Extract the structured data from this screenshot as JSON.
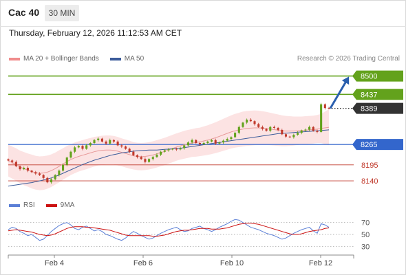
{
  "header": {
    "instrument": "Cac 40",
    "timeframe": "30 MIN"
  },
  "timestamp": "Thursday, February 12, 2026 11:12:53 AM CET",
  "legend": {
    "bollinger_label": "MA 20 + Bollinger Bands",
    "ma50_label": "MA 50"
  },
  "credit": "Research © 2026 Trading Central",
  "rsi_legend": {
    "rsi_label": "RSI",
    "ma_label": "9MA"
  },
  "colors": {
    "up": "#63a21c",
    "down": "#c0392b",
    "current": "#333333",
    "pivot": "#3366cc",
    "support": "#c0392b",
    "band_fill": "#fbdcdc",
    "ma20": "#e89a9a",
    "ma50": "#3b5b9a",
    "rsi": "#5b7fd6",
    "rsi_ma": "#cc1111",
    "arrow": "#2a5fae"
  },
  "chart_data": [
    {
      "type": "candlestick",
      "title": "",
      "x_ticks": [
        "Feb 4",
        "Feb 6",
        "Feb 10",
        "Feb 12"
      ],
      "ylim": [
        8100,
        8525
      ],
      "levels": [
        {
          "label": "8500",
          "value": 8500,
          "kind": "resistance"
        },
        {
          "label": "8437",
          "value": 8437,
          "kind": "resistance"
        },
        {
          "label": "8389",
          "value": 8389,
          "kind": "current"
        },
        {
          "label": "8265",
          "value": 8265,
          "kind": "pivot"
        },
        {
          "label": "8195",
          "value": 8195,
          "kind": "support"
        },
        {
          "label": "8140",
          "value": 8140,
          "kind": "support"
        }
      ],
      "close_series": [
        8210,
        8205,
        8190,
        8180,
        8185,
        8175,
        8170,
        8165,
        8160,
        8150,
        8135,
        8145,
        8160,
        8175,
        8195,
        8220,
        8240,
        8255,
        8260,
        8250,
        8262,
        8270,
        8280,
        8285,
        8275,
        8268,
        8280,
        8275,
        8262,
        8258,
        8250,
        8240,
        8228,
        8222,
        8215,
        8205,
        8215,
        8222,
        8230,
        8240,
        8245,
        8248,
        8250,
        8248,
        8252,
        8262,
        8272,
        8280,
        8270,
        8266,
        8270,
        8275,
        8280,
        8268,
        8272,
        8278,
        8284,
        8290,
        8305,
        8325,
        8340,
        8350,
        8345,
        8335,
        8325,
        8318,
        8312,
        8325,
        8322,
        8315,
        8300,
        8292,
        8290,
        8298,
        8305,
        8313,
        8316,
        8325,
        8312,
        8308,
        8403,
        8390,
        8389
      ],
      "ma20": [
        8210,
        8203,
        8196,
        8188,
        8182,
        8177,
        8172,
        8168,
        8166,
        8167,
        8170,
        8175,
        8182,
        8190,
        8198,
        8206,
        8213,
        8219,
        8224,
        8228,
        8232,
        8236,
        8240,
        8243,
        8245,
        8246,
        8246,
        8245,
        8242,
        8238,
        8234,
        8230,
        8226,
        8224,
        8223,
        8224,
        8226,
        8229,
        8233,
        8237,
        8241,
        8246,
        8251,
        8256,
        8260,
        8264,
        8267,
        8270,
        8272,
        8274,
        8277,
        8280,
        8284,
        8288,
        8293,
        8298,
        8303,
        8308,
        8312,
        8315,
        8318,
        8320,
        8321,
        8322,
        8322,
        8321,
        8320,
        8318,
        8316,
        8314,
        8312,
        8311,
        8311,
        8311,
        8312,
        8313,
        8314,
        8315,
        8316,
        8318,
        8320,
        8322,
        8324
      ],
      "ma50": [
        8122,
        8124,
        8126,
        8128,
        8130,
        8132,
        8134,
        8137,
        8140,
        8143,
        8146,
        8150,
        8155,
        8160,
        8166,
        8172,
        8178,
        8184,
        8190,
        8196,
        8201,
        8206,
        8211,
        8215,
        8219,
        8223,
        8227,
        8230,
        8233,
        8236,
        8238,
        8240,
        8242,
        8243,
        8244,
        8245,
        8246,
        8246,
        8246,
        8247,
        8248,
        8249,
        8250,
        8251,
        8252,
        8254,
        8256,
        8258,
        8260,
        8262,
        8264,
        8266,
        8268,
        8270,
        8272,
        8274,
        8276,
        8278,
        8280,
        8282,
        8284,
        8286,
        8288,
        8290,
        8292,
        8294,
        8296,
        8298,
        8300,
        8302,
        8303,
        8304,
        8305,
        8306,
        8307,
        8308,
        8309,
        8310,
        8311,
        8312,
        8313,
        8314,
        8315
      ],
      "band_width": [
        55,
        55,
        56,
        56,
        57,
        57,
        58,
        58,
        58,
        58,
        57,
        56,
        55,
        55,
        54,
        54,
        53,
        53,
        52,
        52,
        52,
        51,
        51,
        50,
        50,
        50,
        50,
        49,
        49,
        48,
        48,
        48,
        47,
        47,
        47,
        47,
        47,
        47,
        47,
        47,
        47,
        47,
        47,
        47,
        47,
        48,
        48,
        48,
        49,
        49,
        50,
        51,
        52,
        53,
        54,
        55,
        56,
        57,
        58,
        59,
        60,
        60,
        60,
        60,
        59,
        58,
        57,
        56,
        55,
        54,
        53,
        52,
        51,
        50,
        49,
        48,
        48,
        48,
        48,
        48,
        50,
        56,
        62
      ],
      "forecast": {
        "from": 8389,
        "to": 8500
      }
    },
    {
      "type": "line",
      "title": "",
      "ylim": [
        20,
        80
      ],
      "y_ticks": [
        "70",
        "50",
        "30"
      ],
      "series": [
        {
          "name": "RSI",
          "values": [
            58,
            62,
            60,
            55,
            52,
            48,
            50,
            45,
            40,
            42,
            48,
            55,
            60,
            65,
            68,
            70,
            66,
            60,
            58,
            62,
            64,
            60,
            56,
            58,
            55,
            50,
            48,
            45,
            42,
            40,
            44,
            50,
            55,
            52,
            48,
            45,
            42,
            44,
            48,
            52,
            55,
            58,
            60,
            62,
            58,
            55,
            56,
            60,
            62,
            64,
            60,
            58,
            55,
            58,
            62,
            65,
            68,
            72,
            75,
            74,
            70,
            66,
            62,
            60,
            58,
            55,
            52,
            50,
            48,
            45,
            42,
            44,
            48,
            52,
            55,
            58,
            60,
            62,
            56,
            52,
            68,
            66,
            62
          ]
        },
        {
          "name": "9MA",
          "values": [
            56,
            57,
            58,
            57,
            56,
            55,
            54,
            52,
            50,
            49,
            48,
            49,
            51,
            54,
            57,
            60,
            62,
            63,
            63,
            63,
            62,
            62,
            61,
            60,
            59,
            58,
            57,
            55,
            53,
            51,
            49,
            48,
            48,
            48,
            48,
            48,
            48,
            47,
            47,
            48,
            49,
            51,
            53,
            55,
            56,
            57,
            57,
            58,
            59,
            60,
            60,
            60,
            59,
            59,
            59,
            60,
            61,
            63,
            65,
            67,
            68,
            69,
            69,
            68,
            67,
            65,
            63,
            61,
            59,
            57,
            55,
            53,
            51,
            50,
            50,
            51,
            53,
            55,
            56,
            57,
            58,
            60,
            61
          ]
        }
      ]
    }
  ]
}
